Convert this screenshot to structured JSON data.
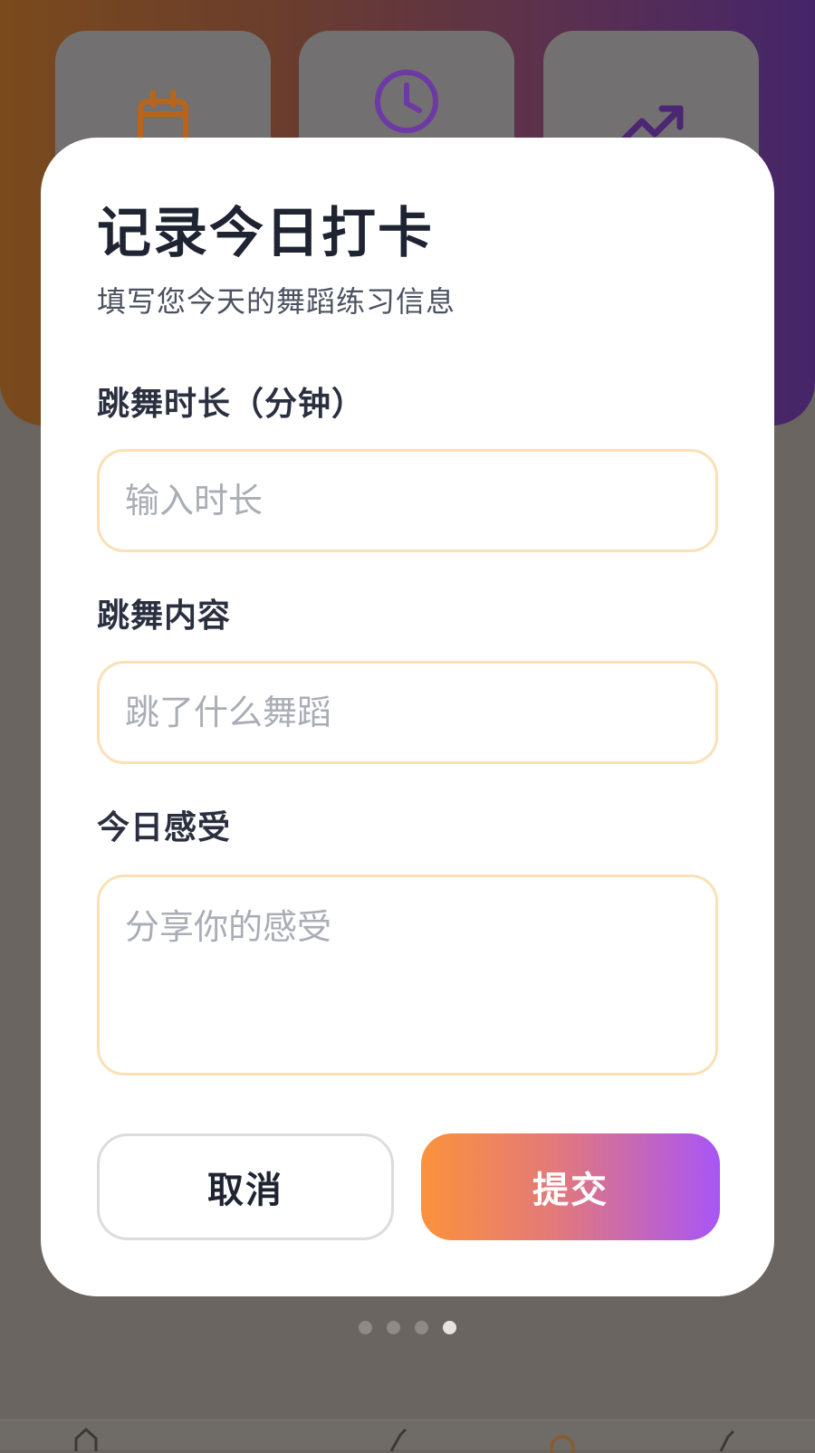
{
  "background": {
    "cards": [
      {
        "icon": "calendar-icon",
        "color": "#b8651b"
      },
      {
        "icon": "clock-icon",
        "color": "#6d3aa5"
      },
      {
        "icon": "trending-up-icon",
        "color": "#4a2673"
      }
    ],
    "pager": {
      "count": 4,
      "active_index": 3
    }
  },
  "modal": {
    "title": "记录今日打卡",
    "subtitle": "填写您今天的舞蹈练习信息",
    "fields": {
      "duration": {
        "label": "跳舞时长（分钟）",
        "placeholder": "输入时长",
        "value": ""
      },
      "content": {
        "label": "跳舞内容",
        "placeholder": "跳了什么舞蹈",
        "value": ""
      },
      "feeling": {
        "label": "今日感受",
        "placeholder": "分享你的感受",
        "value": ""
      }
    },
    "buttons": {
      "cancel": "取消",
      "submit": "提交"
    }
  },
  "colors": {
    "input_border": "#fbe0b6",
    "submit_gradient_start": "#fb923c",
    "submit_gradient_end": "#a855f7",
    "title": "#1f2433"
  }
}
